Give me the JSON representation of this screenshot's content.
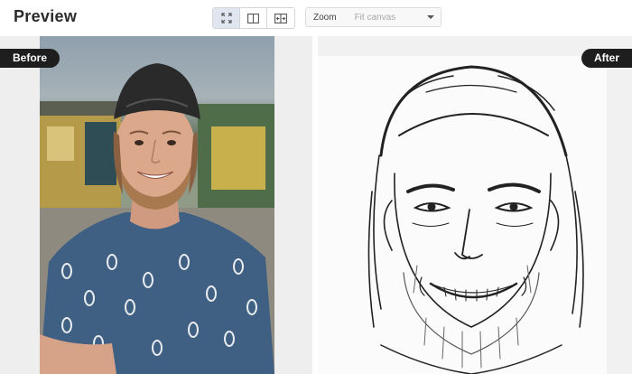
{
  "header": {
    "title": "Preview",
    "view_modes": [
      {
        "icon": "fit-screen-icon",
        "active": true
      },
      {
        "icon": "split-view-icon",
        "active": false
      },
      {
        "icon": "compare-slider-icon",
        "active": false
      }
    ],
    "zoom": {
      "label": "Zoom",
      "value": "Fit canvas",
      "icon": "chevron-down-icon"
    }
  },
  "preview": {
    "before_label": "Before",
    "after_label": "After"
  },
  "colors": {
    "label_bg": "#1e1e1e",
    "active_btn": "#dfe6f0",
    "canvas_bg": "#eeeeee"
  }
}
